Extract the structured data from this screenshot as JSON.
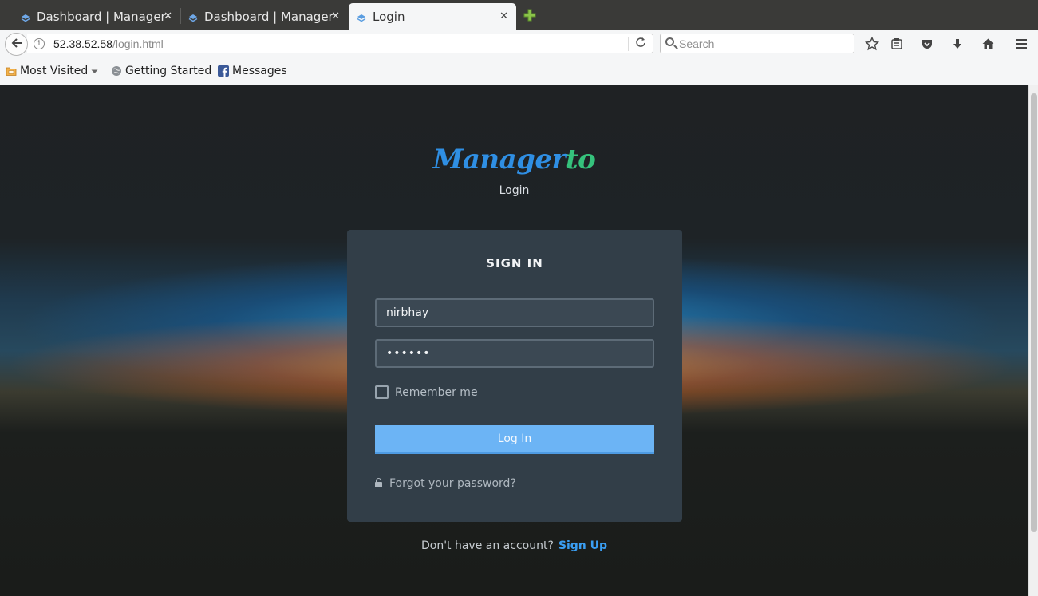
{
  "browser": {
    "tabs": [
      {
        "title": "Dashboard | Manager",
        "active": false
      },
      {
        "title": "Dashboard | Manager",
        "active": false
      },
      {
        "title": "Login",
        "active": true
      }
    ],
    "url_host": "52.38.52.58",
    "url_path": "/login.html",
    "search_placeholder": "Search",
    "bookmarks": [
      {
        "label": "Most Visited",
        "icon": "folder-icon",
        "dropdown": true
      },
      {
        "label": "Getting Started",
        "icon": "globe-icon"
      },
      {
        "label": "Messages",
        "icon": "facebook-icon"
      }
    ],
    "toolbar_icons": [
      "bookmark-star-icon",
      "reading-list-icon",
      "pocket-icon",
      "download-icon",
      "home-icon",
      "menu-icon"
    ]
  },
  "page": {
    "brand_part1": "Manager",
    "brand_part2": "to",
    "subtitle": "Login",
    "card_title": "SIGN IN",
    "username_value": "nirbhay",
    "password_mask": "••••••",
    "remember_label": "Remember me",
    "remember_checked": false,
    "login_label": "Log In",
    "forgot_label": "Forgot your password?",
    "signup_prompt": "Don't have an account?",
    "signup_link": "Sign Up"
  },
  "colors": {
    "brand_blue": "#2f8fe4",
    "brand_green": "#35c27c",
    "card_bg": "#323e48",
    "button_bg": "#6cb4f5",
    "link": "#3a9ef2"
  }
}
